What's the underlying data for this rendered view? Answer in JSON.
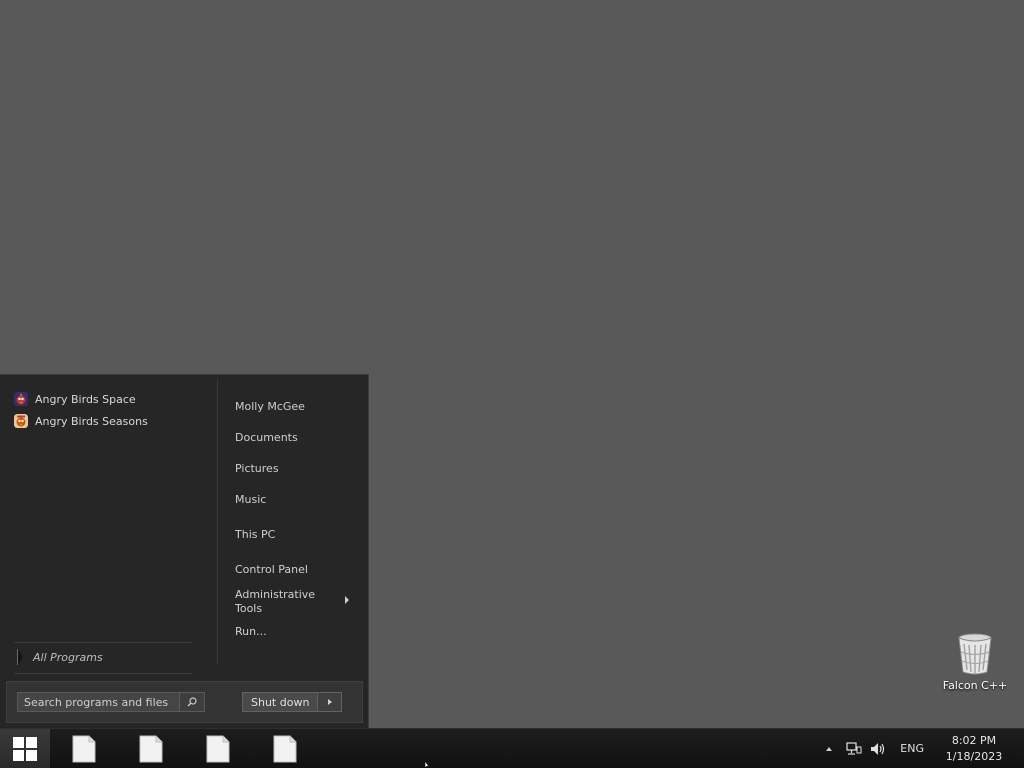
{
  "start_menu": {
    "programs": [
      {
        "label": "Angry Birds Space",
        "icon": "angry-birds-space-icon"
      },
      {
        "label": "Angry Birds Seasons",
        "icon": "angry-birds-seasons-icon"
      }
    ],
    "all_programs": "All Programs",
    "places": {
      "user": "Molly McGee",
      "documents": "Documents",
      "pictures": "Pictures",
      "music": "Music",
      "this_pc": "This PC",
      "control_panel": "Control Panel",
      "admin_tools": "Administrative Tools",
      "run": "Run..."
    },
    "search": {
      "placeholder": "Search programs and files"
    },
    "shutdown_label": "Shut down"
  },
  "desktop": {
    "icons": [
      {
        "label": "Falcon C++",
        "icon": "recycle-bin-icon"
      }
    ]
  },
  "taskbar": {
    "items": [
      "file-icon",
      "file-icon",
      "file-icon",
      "file-icon"
    ],
    "tray": {
      "language": "ENG",
      "time": "8:02 PM",
      "date": "1/18/2023"
    }
  },
  "colors": {
    "desktop": "#595959",
    "menu_bg": "#262626",
    "taskbar_bg": "#151515"
  }
}
